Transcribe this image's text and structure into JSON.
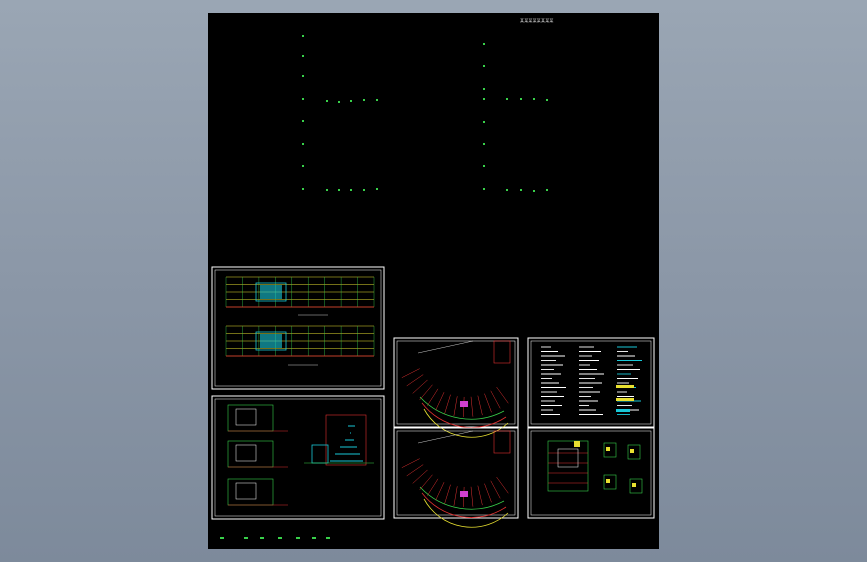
{
  "title": "某某某某某某某某",
  "colors": {
    "background": "#8b97a7",
    "sheet": "#000000",
    "frame": "#ffffff",
    "line_green": "#38d04a",
    "line_red": "#e03030",
    "line_yellow": "#e8e030",
    "line_cyan": "#19c8d8",
    "line_magenta": "#d040d0",
    "text": "#d8d8d8"
  },
  "panels": [
    {
      "name": "drawing-panel-elevations",
      "type": "elevation"
    },
    {
      "name": "drawing-panel-sections",
      "type": "section"
    },
    {
      "name": "drawing-panel-curved-plan-upper",
      "type": "curved-plan"
    },
    {
      "name": "drawing-panel-curved-plan-lower",
      "type": "curved-plan"
    },
    {
      "name": "drawing-panel-design-notes",
      "type": "notes"
    },
    {
      "name": "drawing-panel-details",
      "type": "details"
    }
  ]
}
